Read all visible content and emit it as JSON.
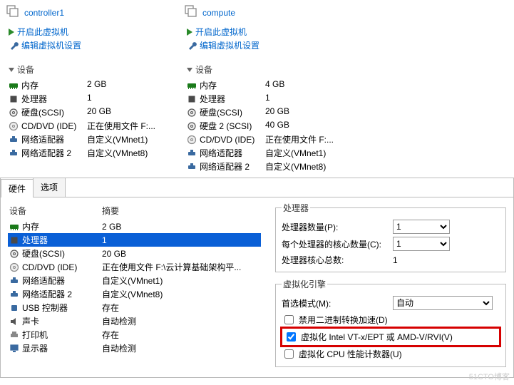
{
  "vms": [
    {
      "name": "controller1",
      "power_on": "开启此虚拟机",
      "edit_settings": "编辑虚拟机设置",
      "section": "设备",
      "devices": [
        {
          "icon": "memory",
          "label": "内存",
          "value": "2 GB"
        },
        {
          "icon": "cpu",
          "label": "处理器",
          "value": "1"
        },
        {
          "icon": "disk",
          "label": "硬盘(SCSI)",
          "value": "20 GB"
        },
        {
          "icon": "cd",
          "label": "CD/DVD (IDE)",
          "value": "正在使用文件 F:..."
        },
        {
          "icon": "net",
          "label": "网络适配器",
          "value": "自定义(VMnet1)"
        },
        {
          "icon": "net",
          "label": "网络适配器 2",
          "value": "自定义(VMnet8)"
        }
      ]
    },
    {
      "name": "compute",
      "power_on": "开启此虚拟机",
      "edit_settings": "编辑虚拟机设置",
      "section": "设备",
      "devices": [
        {
          "icon": "memory",
          "label": "内存",
          "value": "4 GB"
        },
        {
          "icon": "cpu",
          "label": "处理器",
          "value": "1"
        },
        {
          "icon": "disk",
          "label": "硬盘(SCSI)",
          "value": "20 GB"
        },
        {
          "icon": "disk",
          "label": "硬盘 2 (SCSI)",
          "value": "40 GB"
        },
        {
          "icon": "cd",
          "label": "CD/DVD (IDE)",
          "value": "正在使用文件 F:..."
        },
        {
          "icon": "net",
          "label": "网络适配器",
          "value": "自定义(VMnet1)"
        },
        {
          "icon": "net",
          "label": "网络适配器 2",
          "value": "自定义(VMnet8)"
        }
      ]
    }
  ],
  "dialog": {
    "tabs": {
      "hardware": "硬件",
      "options": "选项"
    },
    "list_headers": {
      "device": "设备",
      "summary": "摘要"
    },
    "hw": [
      {
        "icon": "memory",
        "label": "内存",
        "value": "2 GB",
        "selected": false
      },
      {
        "icon": "cpu",
        "label": "处理器",
        "value": "1",
        "selected": true
      },
      {
        "icon": "disk",
        "label": "硬盘(SCSI)",
        "value": "20 GB",
        "selected": false
      },
      {
        "icon": "cd",
        "label": "CD/DVD (IDE)",
        "value": "正在使用文件 F:\\云计算基础架构平...",
        "selected": false
      },
      {
        "icon": "net",
        "label": "网络适配器",
        "value": "自定义(VMnet1)",
        "selected": false
      },
      {
        "icon": "net",
        "label": "网络适配器 2",
        "value": "自定义(VMnet8)",
        "selected": false
      },
      {
        "icon": "usb",
        "label": "USB 控制器",
        "value": "存在",
        "selected": false
      },
      {
        "icon": "sound",
        "label": "声卡",
        "value": "自动检测",
        "selected": false
      },
      {
        "icon": "printer",
        "label": "打印机",
        "value": "存在",
        "selected": false
      },
      {
        "icon": "monitor",
        "label": "显示器",
        "value": "自动检测",
        "selected": false
      }
    ],
    "cpu": {
      "legend_proc": "处理器",
      "num_proc_label": "处理器数量(P):",
      "num_proc_value": "1",
      "cores_label": "每个处理器的核心数量(C):",
      "cores_value": "1",
      "total_label": "处理器核心总数:",
      "total_value": "1",
      "legend_virt": "虚拟化引擎",
      "pref_mode_label": "首选模式(M):",
      "pref_mode_value": "自动",
      "chk_binary": "禁用二进制转换加速(D)",
      "chk_binary_checked": false,
      "chk_vt": "虚拟化 Intel VT-x/EPT 或 AMD-V/RVI(V)",
      "chk_vt_checked": true,
      "chk_counter": "虚拟化 CPU 性能计数器(U)",
      "chk_counter_checked": false
    }
  },
  "watermark": "51CTO博客"
}
